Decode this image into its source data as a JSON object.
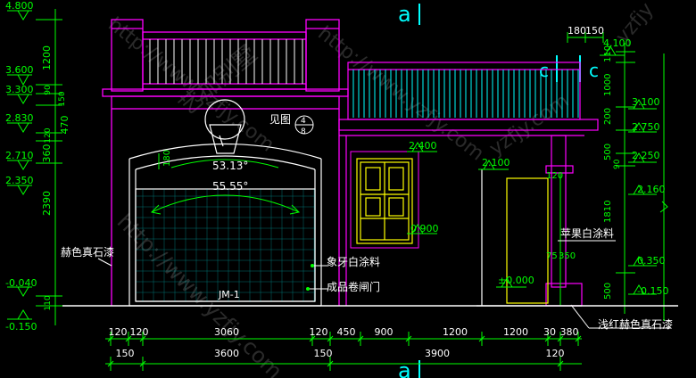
{
  "colors": {
    "background": "#000000",
    "wall": "#ff00ff",
    "dimension": "#00ff00",
    "railing": "#00ffff",
    "window": "#ffff00",
    "outline": "#ffffff",
    "section_mark": "#00ffff"
  },
  "section_marks": {
    "a_top": "a",
    "a_bottom": "a",
    "c_left": "c",
    "c_right": "c"
  },
  "left_levels": [
    "4.800",
    "3.600",
    "3.300",
    "2.830",
    "2.710",
    "2.350",
    "-0.040",
    "-0.150"
  ],
  "left_dims": [
    "1200",
    "90",
    "150",
    "470",
    "120",
    "360",
    "2390",
    "110"
  ],
  "right_levels": [
    "4.100",
    "3.100",
    "2.750",
    "2.250",
    "2.160",
    "0.350",
    "-0.150"
  ],
  "right_dims": [
    "110",
    "1000",
    "200",
    "500",
    "90",
    "1810",
    "500"
  ],
  "top_right_dims": [
    "180",
    "150"
  ],
  "annotations": {
    "see_detail": "见图",
    "detail_num": "4",
    "detail_sheet": "8",
    "angle_1": "53.13°",
    "angle_2": "55.55°",
    "arch_dim": "180",
    "door_tag": "JM-1",
    "ivory_paint": "象牙白涂料",
    "rolling_door": "成品卷闸门",
    "brown_stone": "赫色真石漆",
    "apple_white": "苹果白涂料",
    "light_red_stone": "浅红赫色真石漆",
    "window_top": "2.400",
    "window_sill": "0.900",
    "door_top": "2.100",
    "floor_level": "±0.000",
    "col_dim_120": "120",
    "col_dim_75": "75",
    "col_dim_350": "350"
  },
  "bottom_dims_row1": [
    "120",
    "120",
    "3060",
    "120",
    "450",
    "900",
    "1200",
    "1200",
    "30",
    "380"
  ],
  "bottom_dims_row2": [
    "150",
    "3600",
    "150",
    "3900",
    "120"
  ],
  "watermark": {
    "url_a": "http://www.yzfjy.com",
    "url_b": "http://www.yzfjy.com",
    "url_c": "yzfjy.com",
    "url_d": "yzfjy",
    "brand": "艺加别墅"
  }
}
